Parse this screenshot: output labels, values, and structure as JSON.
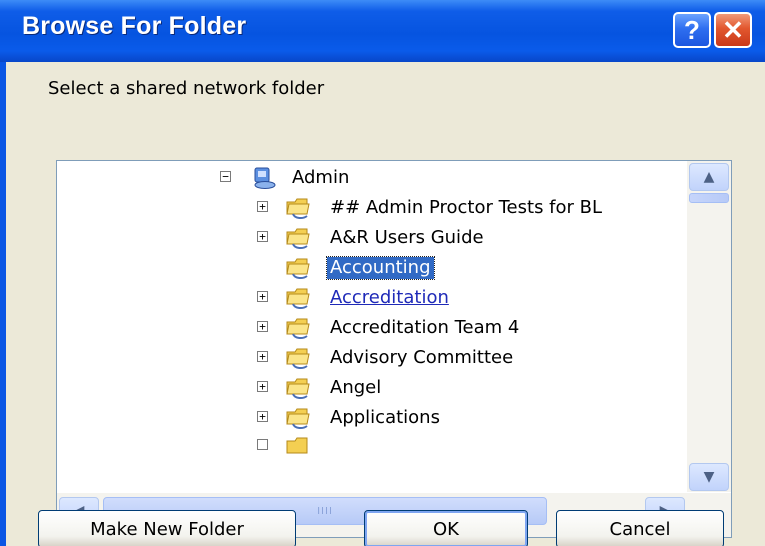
{
  "window": {
    "title": "Browse For Folder",
    "help_icon_glyph": "?",
    "close_icon_glyph": "✕"
  },
  "prompt": "Select a shared network folder",
  "tree": {
    "root": {
      "label": "Admin",
      "expanded": true,
      "icon": "network-computer-icon"
    },
    "items": [
      {
        "label": "## Admin Proctor Tests for BL",
        "expandable": true,
        "state": "normal"
      },
      {
        "label": "A&R Users Guide",
        "expandable": true,
        "state": "normal"
      },
      {
        "label": "Accounting",
        "expandable": false,
        "state": "selected"
      },
      {
        "label": "Accreditation",
        "expandable": true,
        "state": "hover"
      },
      {
        "label": "Accreditation Team 4",
        "expandable": true,
        "state": "normal"
      },
      {
        "label": "Advisory Committee",
        "expandable": true,
        "state": "normal"
      },
      {
        "label": "Angel",
        "expandable": true,
        "state": "normal"
      },
      {
        "label": "Applications",
        "expandable": true,
        "state": "normal"
      }
    ],
    "expand_glyph": "+",
    "collapse_glyph": "−",
    "item_icon": "shared-folder-icon"
  },
  "scrollbars": {
    "up_glyph": "▲",
    "down_glyph": "▼",
    "left_glyph": "◀",
    "right_glyph": "▶",
    "grip_glyph": "IIII"
  },
  "buttons": {
    "make_new_folder": "Make New Folder",
    "ok": "OK",
    "cancel": "Cancel"
  },
  "colors": {
    "titlebar": "#0654e0",
    "selection": "#316ac5",
    "client_background": "#ece9d8",
    "close_button": "#e2572e"
  }
}
